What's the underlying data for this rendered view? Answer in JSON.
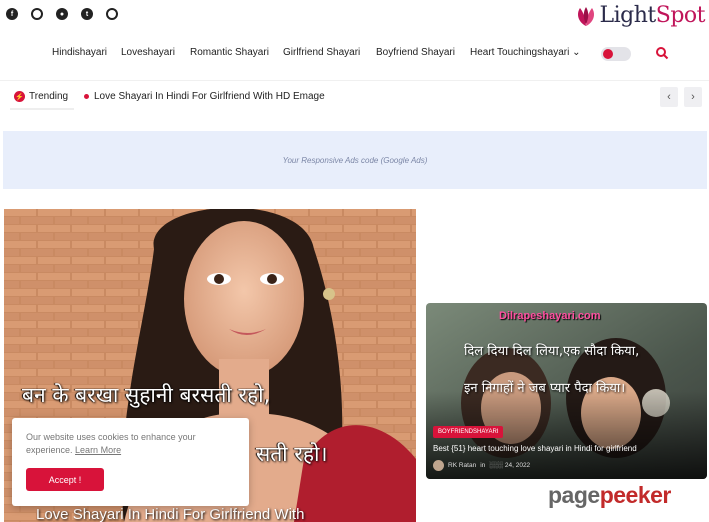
{
  "social": [
    "facebook-icon",
    "whatsapp-icon",
    "circle-icon",
    "twitter-icon",
    "instagram-icon"
  ],
  "logo": {
    "part1": "Light",
    "part2": "Spot",
    "accent": "#c0155a"
  },
  "nav": {
    "items": [
      "Hindishayari",
      "Loveshayari",
      "Romantic Shayari",
      "Girlfriend Shayari",
      "Boyfriend Shayari",
      "Heart Touchingshayari ⌄"
    ]
  },
  "trending": {
    "label": "Trending",
    "link": "Love Shayari In Hindi For Girlfriend With HD Emage",
    "prev": "‹",
    "next": "›"
  },
  "ad": {
    "text": "Your Responsive Ads code (Google Ads)"
  },
  "hero": {
    "line1": "बन के बरखा सुहानी बरसती रहो,",
    "line2": "सती रहो।",
    "title": "Love Shayari In Hindi For Girlfriend With"
  },
  "cookie": {
    "text": "Our website uses cookies to enhance your experience.",
    "learn_more": "Learn More",
    "accept": "Accept !"
  },
  "card": {
    "site": "Dilrapeshayari.com",
    "line1": "दिल दिया दिल लिया,एक सौदा किया,",
    "line2": "इन निगाहों ने जब प्यार पैदा किया।",
    "category": "BOYFRIENDSHAYARI",
    "title": "Best {51} heart touching love shayari in Hindi for girlfriend",
    "author": "RK Ratan",
    "date_prefix": "in",
    "date": "░░░ 24, 2022"
  },
  "watermark": {
    "part1": "page",
    "part2": "peeker"
  },
  "colors": {
    "accent": "#d8133a",
    "ad_bg": "#e8eefb"
  }
}
